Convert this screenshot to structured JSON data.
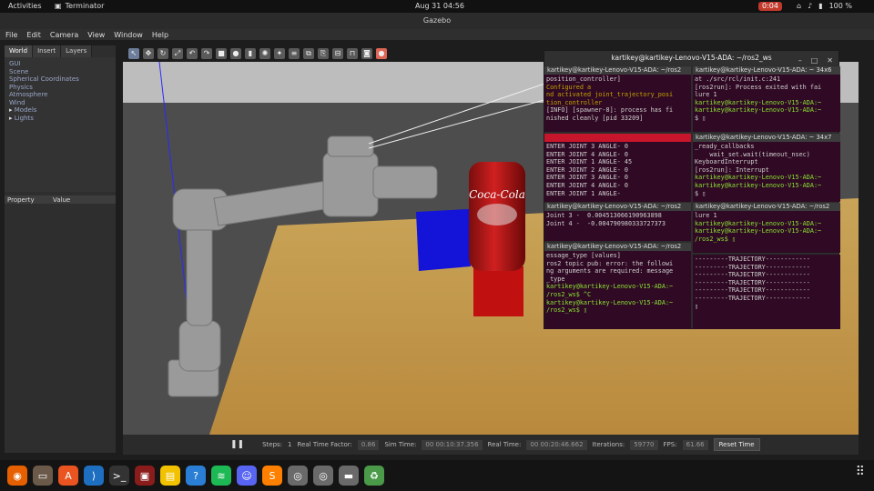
{
  "topbar": {
    "activities": "Activities",
    "app_name": "Terminator",
    "clock": "Aug 31  04:56",
    "recording": "0:04",
    "battery": "100 %"
  },
  "gazebo": {
    "title": "Gazebo",
    "menu": [
      "File",
      "Edit",
      "Camera",
      "View",
      "Window",
      "Help"
    ],
    "tabs": [
      "World",
      "Insert",
      "Layers"
    ],
    "tree": [
      {
        "label": "GUI",
        "expandable": false
      },
      {
        "label": "Scene",
        "expandable": false
      },
      {
        "label": "Spherical Coordinates",
        "expandable": false
      },
      {
        "label": "Physics",
        "expandable": false
      },
      {
        "label": "Atmosphere",
        "expandable": false
      },
      {
        "label": "Wind",
        "expandable": false
      },
      {
        "label": "Models",
        "expandable": true
      },
      {
        "label": "Lights",
        "expandable": true
      }
    ],
    "prop_headers": [
      "Property",
      "Value"
    ],
    "status": {
      "steps_label": "Steps:",
      "steps_value": "1",
      "rtf_label": "Real Time Factor:",
      "rtf_value": "0.86",
      "sim_label": "Sim Time:",
      "sim_value": "00 00:10:37.356",
      "real_label": "Real Time:",
      "real_value": "00 00:20:46.662",
      "iter_label": "Iterations:",
      "iter_value": "59770",
      "fps_label": "FPS:",
      "fps_value": "61.66",
      "reset": "Reset Time"
    }
  },
  "terminal": {
    "title": "kartikey@kartikey-Lenovo-V15-ADA: ~/ros2_ws",
    "panes": {
      "p1": {
        "title": "kartikey@kartikey-Lenovo-V15-ADA: ~/ros2",
        "lines": [
          [
            "p",
            "position_controller] "
          ],
          [
            "y",
            "Configured a"
          ],
          [
            "y",
            "nd activated joint_trajectory_posi"
          ],
          [
            "y",
            "tion_controller"
          ],
          [
            "p",
            "[INFO] [spawner-8]: process has fi"
          ],
          [
            "p",
            "nished cleanly [pid 33209]"
          ]
        ]
      },
      "p2": {
        "title": "kartikey@kartikey-Lenovo-V15-ADA: ~ 34x6",
        "lines": [
          [
            "p",
            "at ./src/rcl/init.c:241"
          ],
          [
            "p",
            "[ros2run]: Process exited with fai"
          ],
          [
            "p",
            "lure 1"
          ],
          [
            "g",
            "kartikey@kartikey-Lenovo-V15-ADA:~"
          ],
          [
            "g",
            "kartikey@kartikey-Lenovo-V15-ADA:~"
          ],
          [
            "p",
            "$ ▯"
          ]
        ]
      },
      "p3": {
        "title": "kartikey@kartikey-Lenovo-V15-ADA: ~/ros2",
        "lines": [
          [
            "p",
            "ENTER JOINT 3 ANGLE- 0"
          ],
          [
            "p",
            "ENTER JOINT 4 ANGLE- 0"
          ],
          [
            "p",
            "ENTER JOINT 1 ANGLE- 45"
          ],
          [
            "p",
            "ENTER JOINT 2 ANGLE- 0"
          ],
          [
            "p",
            "ENTER JOINT 3 ANGLE- 0"
          ],
          [
            "p",
            "ENTER JOINT 4 ANGLE- 0"
          ],
          [
            "p",
            "ENTER JOINT 1 ANGLE-"
          ]
        ]
      },
      "p4": {
        "title": "kartikey@kartikey-Lenovo-V15-ADA: ~ 34x7",
        "lines": [
          [
            "p",
            "_ready_callbacks"
          ],
          [
            "p",
            "    wait_set.wait(timeout_nsec)"
          ],
          [
            "p",
            "KeyboardInterrupt"
          ],
          [
            "p",
            "[ros2run]: Interrupt"
          ],
          [
            "g",
            "kartikey@kartikey-Lenovo-V15-ADA:~"
          ],
          [
            "g",
            "kartikey@kartikey-Lenovo-V15-ADA:~"
          ],
          [
            "p",
            "$ ▯"
          ]
        ]
      },
      "p5": {
        "title": "kartikey@kartikey-Lenovo-V15-ADA: ~/ros2",
        "lines": [
          [
            "p",
            "Joint 3 -  0.004513066190963898"
          ],
          [
            "p",
            "Joint 4 -  -0.004790980333727373"
          ]
        ]
      },
      "p6": {
        "title": "kartikey@kartikey-Lenovo-V15-ADA: ~/ros2",
        "lines": [
          [
            "p",
            "lure 1"
          ],
          [
            "g",
            "kartikey@kartikey-Lenovo-V15-ADA:~"
          ],
          [
            "g",
            "kartikey@kartikey-Lenovo-V15-ADA:~"
          ],
          [
            "g",
            "/ros2_ws$ ▯"
          ]
        ]
      },
      "p7": {
        "title": "kartikey@kartikey-Lenovo-V15-ADA: ~/ros2",
        "lines": [
          [
            "p",
            "essage_type [values]"
          ],
          [
            "p",
            "ros2 topic pub: error: the followi"
          ],
          [
            "p",
            "ng arguments are required: message"
          ],
          [
            "p",
            "_type"
          ],
          [
            "g",
            "kartikey@kartikey-Lenovo-V15-ADA:~"
          ],
          [
            "g",
            "/ros2_ws$ ^C"
          ],
          [
            "g",
            "kartikey@kartikey-Lenovo-V15-ADA:~"
          ],
          [
            "g",
            "/ros2_ws$ ▯"
          ]
        ]
      },
      "p8": {
        "title": "",
        "lines": [
          [
            "p",
            "---------TRAJECTORY------------"
          ],
          [
            "p",
            "---------TRAJECTORY------------"
          ],
          [
            "p",
            "---------TRAJECTORY------------"
          ],
          [
            "p",
            "---------TRAJECTORY------------"
          ],
          [
            "p",
            "---------TRAJECTORY------------"
          ],
          [
            "p",
            "---------TRAJECTORY------------"
          ],
          [
            "p",
            "▯"
          ]
        ]
      }
    }
  },
  "scene": {
    "can_label": "Coca-Cola"
  },
  "dock": [
    {
      "name": "firefox-icon",
      "color": "#e66000",
      "glyph": "◉"
    },
    {
      "name": "files-icon",
      "color": "#6b5a4a",
      "glyph": "▭"
    },
    {
      "name": "app-center-icon",
      "color": "#e95420",
      "glyph": "A"
    },
    {
      "name": "vscode-icon",
      "color": "#1f6fc1",
      "glyph": "⟩"
    },
    {
      "name": "terminal-icon",
      "color": "#333333",
      "glyph": ">_"
    },
    {
      "name": "terminator-icon",
      "color": "#8a1c1c",
      "glyph": "▣"
    },
    {
      "name": "office-icon",
      "color": "#f2c200",
      "glyph": "▤"
    },
    {
      "name": "help-icon",
      "color": "#2a7fd4",
      "glyph": "?"
    },
    {
      "name": "spotify-icon",
      "color": "#1db954",
      "glyph": "≋"
    },
    {
      "name": "discord-icon",
      "color": "#5865f2",
      "glyph": "☺"
    },
    {
      "name": "sublime-icon",
      "color": "#ff8000",
      "glyph": "S"
    },
    {
      "name": "disk-icon",
      "color": "#6a6a6a",
      "glyph": "◎"
    },
    {
      "name": "disk2-icon",
      "color": "#6a6a6a",
      "glyph": "◎"
    },
    {
      "name": "drive-icon",
      "color": "#6a6a6a",
      "glyph": "▬"
    },
    {
      "name": "trash-icon",
      "color": "#4a9a4a",
      "glyph": "♻"
    }
  ]
}
